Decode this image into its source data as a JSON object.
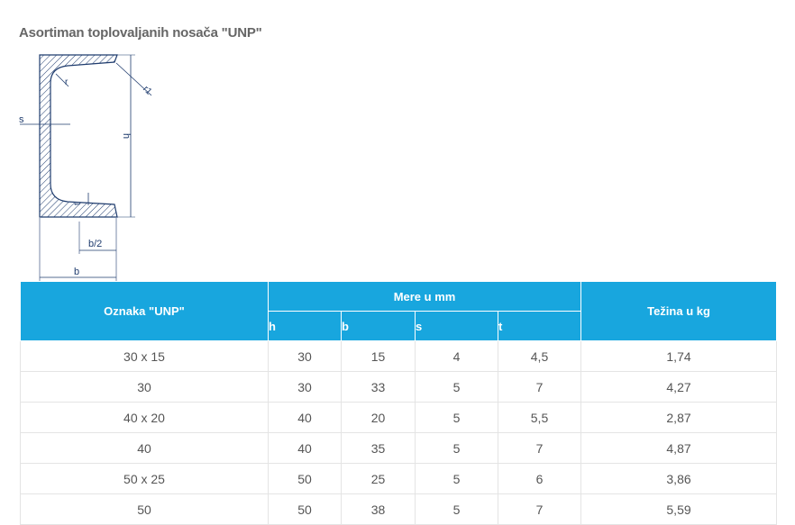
{
  "title": "Asortiman toplovaljanih nosača \"UNP\"",
  "diagram": {
    "labels": {
      "s": "s",
      "h": "h",
      "r": "r",
      "r1": "r1",
      "t": "t",
      "b_half": "b/2",
      "b": "b"
    }
  },
  "table": {
    "header": {
      "oznaka": "Oznaka \"UNP\"",
      "mere": "Mere u mm",
      "tezina": "Težina u kg",
      "sub": {
        "h": "h",
        "b": "b",
        "s": "s",
        "t": "t"
      }
    },
    "rows": [
      [
        "30 x 15",
        "30",
        "15",
        "4",
        "4,5",
        "1,74"
      ],
      [
        "30",
        "30",
        "33",
        "5",
        "7",
        "4,27"
      ],
      [
        "40 x 20",
        "40",
        "20",
        "5",
        "5,5",
        "2,87"
      ],
      [
        "40",
        "40",
        "35",
        "5",
        "7",
        "4,87"
      ],
      [
        "50 x 25",
        "50",
        "25",
        "5",
        "6",
        "3,86"
      ],
      [
        "50",
        "50",
        "38",
        "5",
        "7",
        "5,59"
      ]
    ]
  }
}
